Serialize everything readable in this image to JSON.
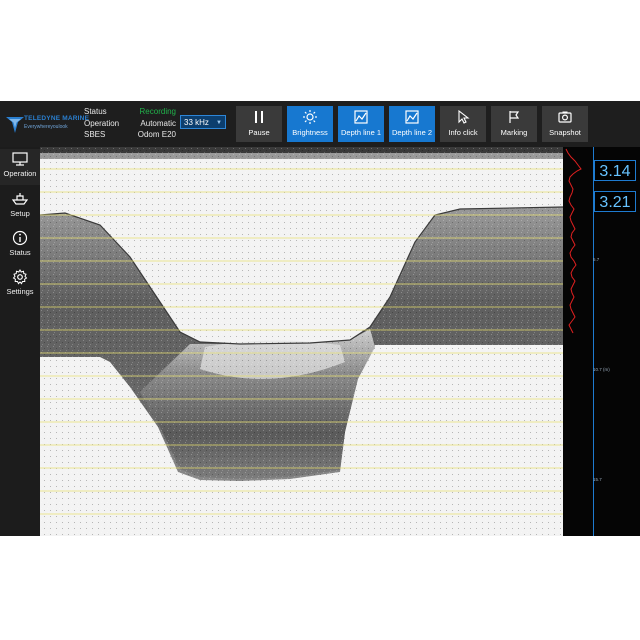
{
  "brand": {
    "name": "TELEDYNE MARINE",
    "tagline": "Everywhereyoulook"
  },
  "status": {
    "rows": [
      {
        "label": "Status",
        "value": "Recording"
      },
      {
        "label": "Operation",
        "value": "Automatic"
      },
      {
        "label": "SBES",
        "value": "Odom E20"
      }
    ],
    "recording_color": "#21b24b"
  },
  "frequency": {
    "selected": "33 kHz"
  },
  "toolbar": {
    "pause": "Pause",
    "brightness": "Brightness",
    "depth_line_1": "Depth line 1",
    "depth_line_2": "Depth line 2",
    "info_click": "Info click",
    "marking": "Marking",
    "snapshot": "Snapshot"
  },
  "sidebar": {
    "operation": "Operation",
    "setup": "Setup",
    "status": "Status",
    "settings": "Settings"
  },
  "depth_scale": {
    "ticks": [
      "5.7",
      "10.7 (m)",
      "15.7"
    ]
  },
  "readouts": {
    "depth_1": "3.14",
    "depth_2": "3.21"
  },
  "colors": {
    "accent": "#1778d0",
    "grid_line": "#e8e070",
    "readout_text": "#66c2ff",
    "graph_line": "#e02020"
  }
}
